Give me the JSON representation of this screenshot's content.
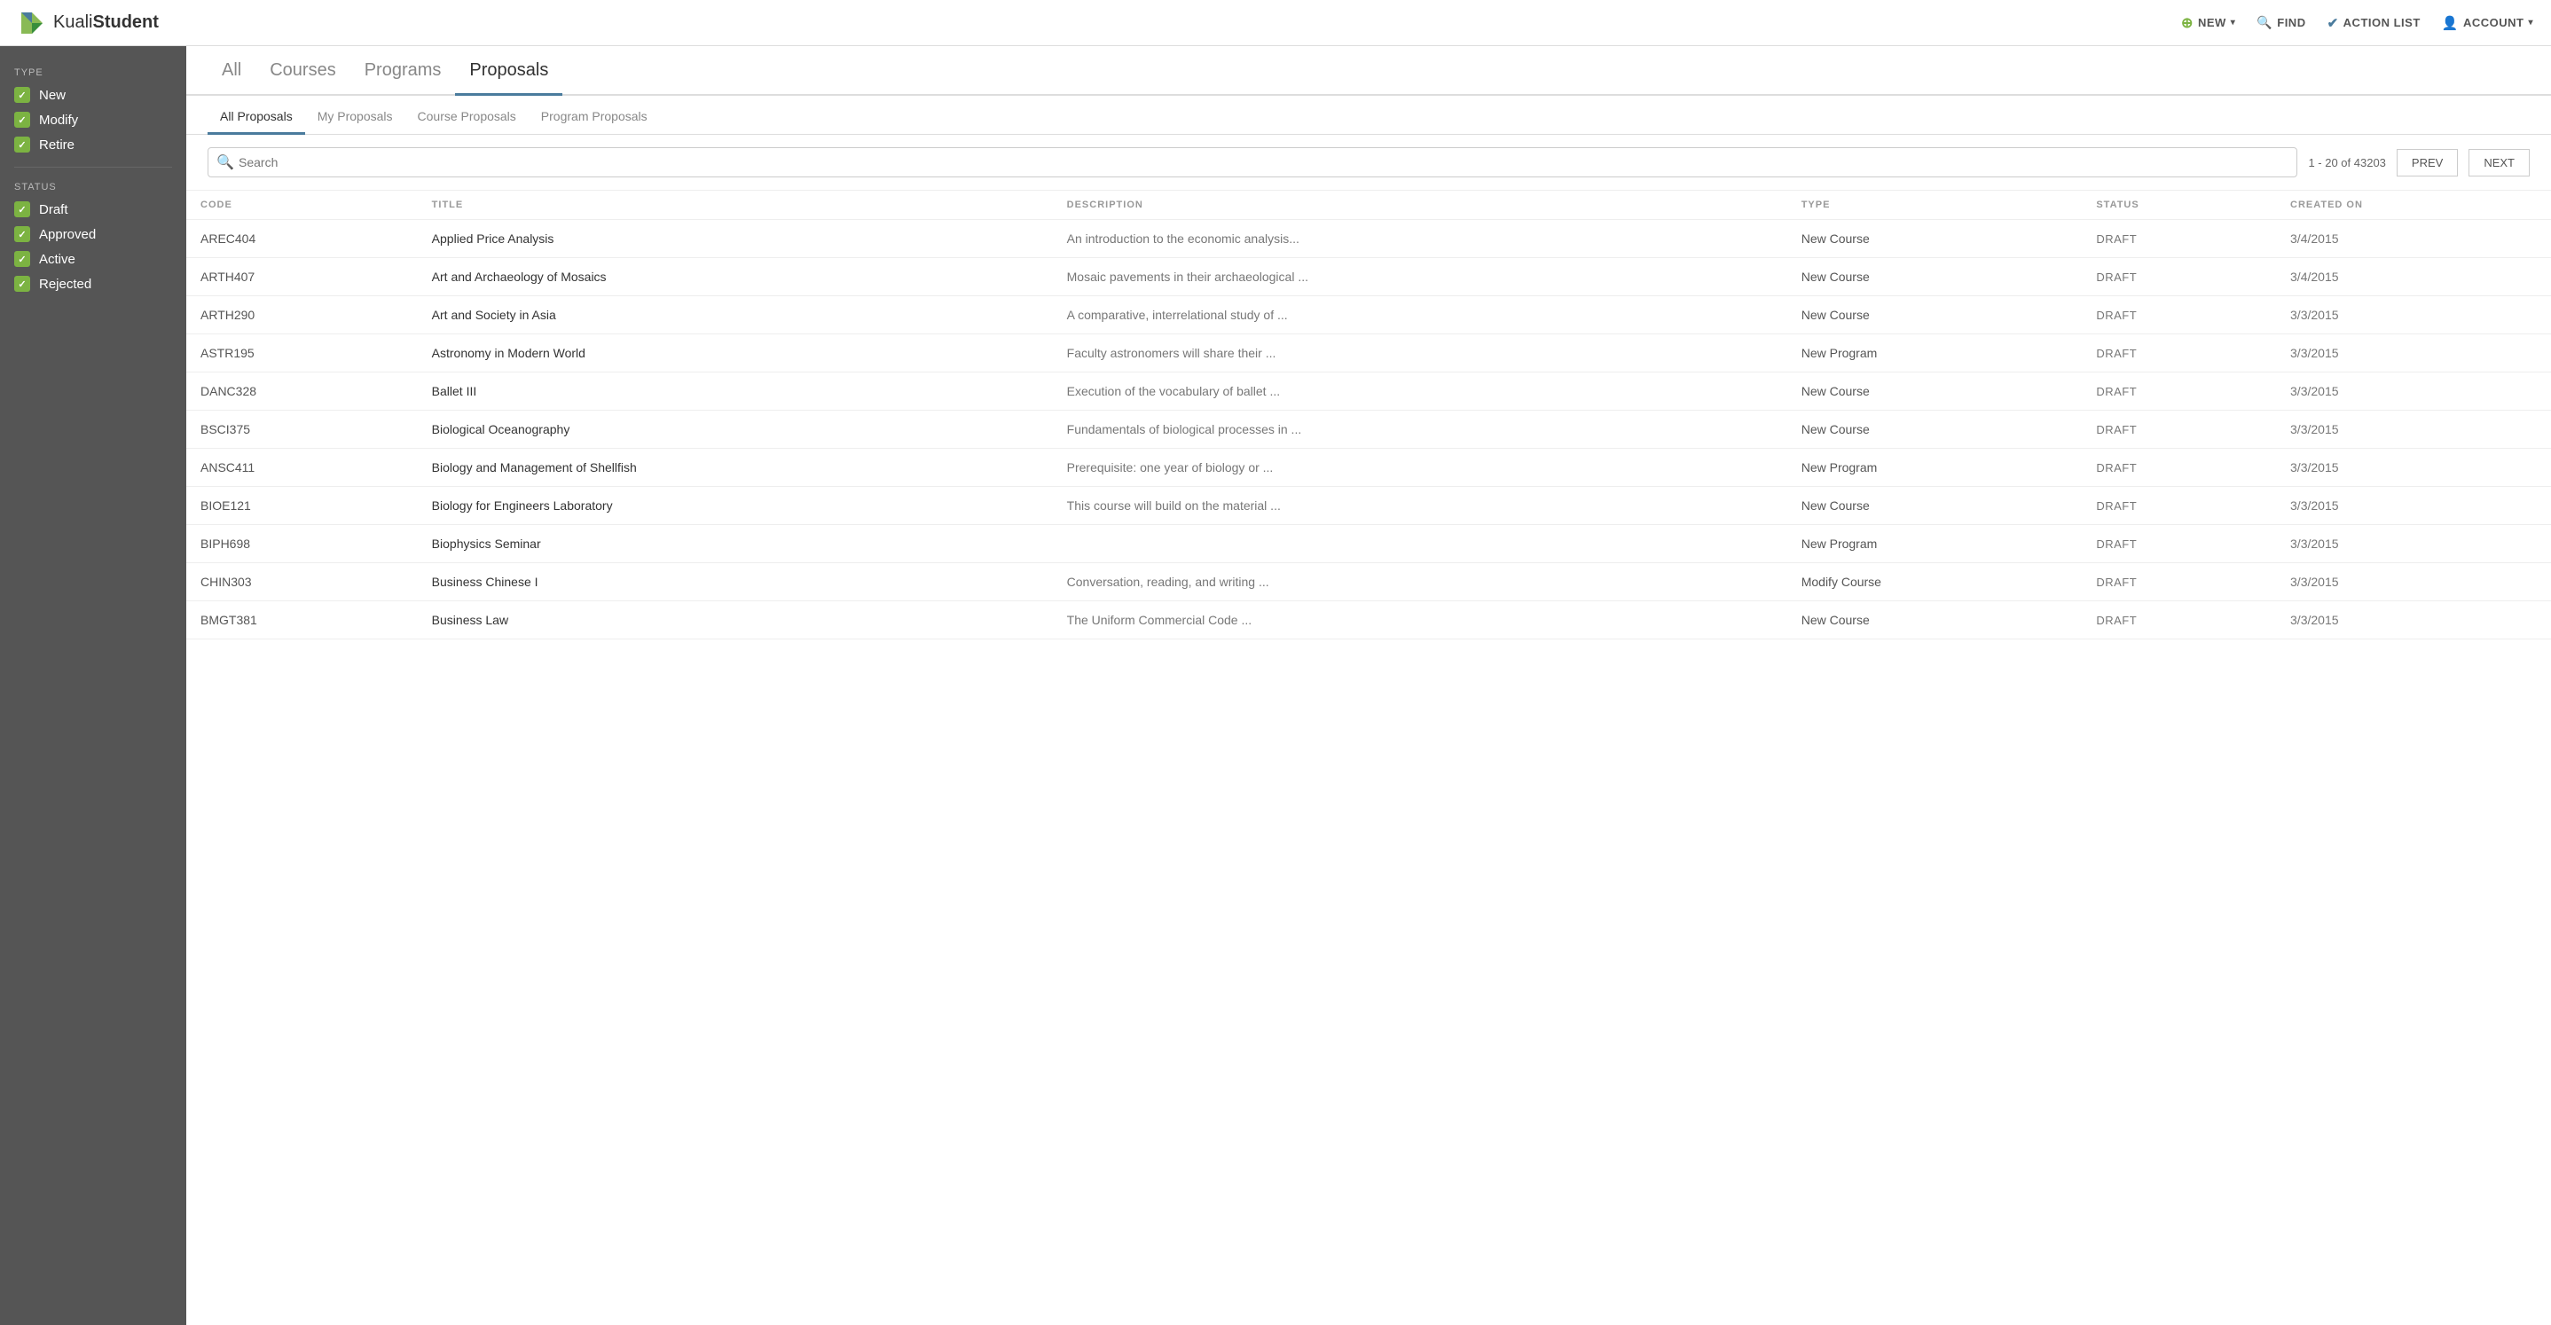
{
  "app": {
    "name_light": "Kuali",
    "name_bold": "Student"
  },
  "top_nav": {
    "new_label": "NEW",
    "find_label": "FIND",
    "action_list_label": "ACTION LIST",
    "account_label": "ACCOUNT"
  },
  "tabs": [
    {
      "id": "all",
      "label": "All"
    },
    {
      "id": "courses",
      "label": "Courses"
    },
    {
      "id": "programs",
      "label": "Programs"
    },
    {
      "id": "proposals",
      "label": "Proposals",
      "active": true
    }
  ],
  "sub_tabs": [
    {
      "id": "all-proposals",
      "label": "All Proposals",
      "active": true
    },
    {
      "id": "my-proposals",
      "label": "My Proposals"
    },
    {
      "id": "course-proposals",
      "label": "Course Proposals"
    },
    {
      "id": "program-proposals",
      "label": "Program Proposals"
    }
  ],
  "sidebar": {
    "type_label": "TYPE",
    "status_label": "STATUS",
    "type_filters": [
      {
        "id": "new",
        "label": "New",
        "checked": true
      },
      {
        "id": "modify",
        "label": "Modify",
        "checked": true
      },
      {
        "id": "retire",
        "label": "Retire",
        "checked": true
      }
    ],
    "status_filters": [
      {
        "id": "draft",
        "label": "Draft",
        "checked": true
      },
      {
        "id": "approved",
        "label": "Approved",
        "checked": true
      },
      {
        "id": "active",
        "label": "Active",
        "checked": true
      },
      {
        "id": "rejected",
        "label": "Rejected",
        "checked": true
      }
    ]
  },
  "search": {
    "placeholder": "Search",
    "pagination": "1 - 20 of 43203",
    "prev_label": "PREV",
    "next_label": "NEXT"
  },
  "table": {
    "columns": [
      "CODE",
      "TITLE",
      "DESCRIPTION",
      "TYPE",
      "STATUS",
      "CREATED ON"
    ],
    "rows": [
      {
        "code": "AREC404",
        "title": "Applied Price Analysis",
        "description": "An introduction to the economic analysis...",
        "type": "New Course",
        "status": "DRAFT",
        "created_on": "3/4/2015"
      },
      {
        "code": "ARTH407",
        "title": "Art and Archaeology of Mosaics",
        "description": "Mosaic pavements in their archaeological ...",
        "type": "New Course",
        "status": "DRAFT",
        "created_on": "3/4/2015"
      },
      {
        "code": "ARTH290",
        "title": "Art and Society in Asia",
        "description": "A comparative, interrelational study of ...",
        "type": "New Course",
        "status": "DRAFT",
        "created_on": "3/3/2015"
      },
      {
        "code": "ASTR195",
        "title": "Astronomy in Modern World",
        "description": "Faculty astronomers will share their ...",
        "type": "New Program",
        "status": "DRAFT",
        "created_on": "3/3/2015"
      },
      {
        "code": "DANC328",
        "title": "Ballet III",
        "description": "Execution of the vocabulary of ballet ...",
        "type": "New Course",
        "status": "DRAFT",
        "created_on": "3/3/2015"
      },
      {
        "code": "BSCI375",
        "title": "Biological Oceanography",
        "description": "Fundamentals of biological processes in ...",
        "type": "New Course",
        "status": "DRAFT",
        "created_on": "3/3/2015"
      },
      {
        "code": "ANSC411",
        "title": "Biology and Management of Shellfish",
        "description": "Prerequisite: one year of biology or ...",
        "type": "New Program",
        "status": "DRAFT",
        "created_on": "3/3/2015"
      },
      {
        "code": "BIOE121",
        "title": "Biology for Engineers Laboratory",
        "description": "This course will build on the material ...",
        "type": "New Course",
        "status": "DRAFT",
        "created_on": "3/3/2015"
      },
      {
        "code": "BIPH698",
        "title": "Biophysics Seminar",
        "description": "",
        "type": "New Program",
        "status": "DRAFT",
        "created_on": "3/3/2015"
      },
      {
        "code": "CHIN303",
        "title": "Business Chinese I",
        "description": "Conversation, reading, and writing ...",
        "type": "Modify Course",
        "status": "DRAFT",
        "created_on": "3/3/2015"
      },
      {
        "code": "BMGT381",
        "title": "Business Law",
        "description": "The Uniform Commercial Code ...",
        "type": "New Course",
        "status": "DRAFT",
        "created_on": "3/3/2015"
      }
    ]
  }
}
